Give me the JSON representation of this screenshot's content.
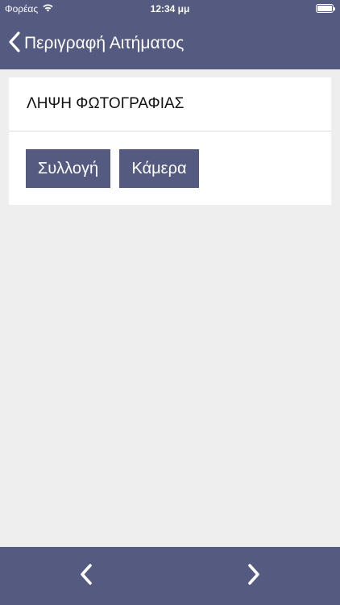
{
  "status_bar": {
    "carrier": "Φορέας",
    "time": "12:34 μμ",
    "battery_level": 1.0
  },
  "nav_bar": {
    "title": "Περιγραφή Αιτήματος",
    "back_icon": "chevron-left-icon"
  },
  "photo_section": {
    "title": "ΛΗΨΗ ΦΩΤΟΓΡΑΦΙΑΣ",
    "gallery_label": "Συλλογή",
    "camera_label": "Κάμερα"
  },
  "bottom_bar": {
    "prev_icon": "chevron-left-icon",
    "next_icon": "chevron-right-icon"
  },
  "colors": {
    "primary": "#555a80",
    "background": "#eeeeee",
    "card": "#ffffff"
  }
}
